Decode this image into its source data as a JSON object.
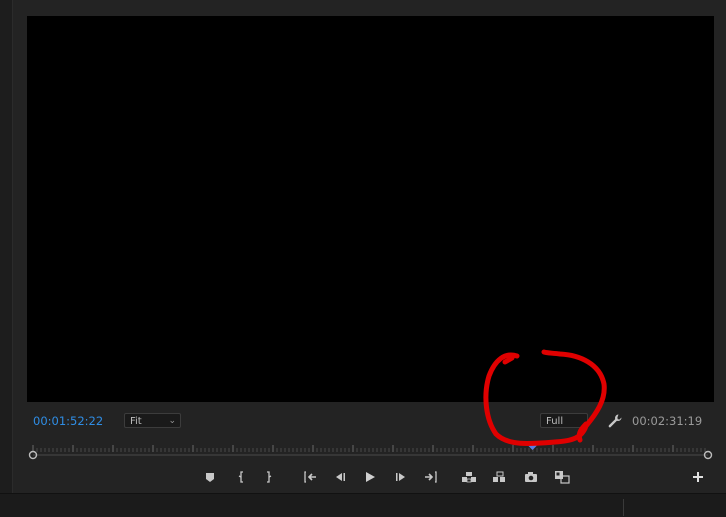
{
  "program_monitor": {
    "current_timecode": "00:01:52:22",
    "duration_timecode": "00:02:31:19",
    "zoom_level": "Fit",
    "playback_resolution": "Full",
    "playhead_position_fraction": 0.74
  },
  "transport_controls": [
    {
      "name": "add-marker-button",
      "icon": "marker-icon"
    },
    {
      "name": "mark-in-button",
      "icon": "mark-in-icon"
    },
    {
      "name": "mark-out-button",
      "icon": "mark-out-icon"
    },
    {
      "name": "go-to-in-button",
      "icon": "go-to-in-icon"
    },
    {
      "name": "step-back-button",
      "icon": "step-back-icon"
    },
    {
      "name": "play-button",
      "icon": "play-icon"
    },
    {
      "name": "step-forward-button",
      "icon": "step-forward-icon"
    },
    {
      "name": "go-to-out-button",
      "icon": "go-to-out-icon"
    },
    {
      "name": "lift-button",
      "icon": "lift-icon"
    },
    {
      "name": "extract-button",
      "icon": "extract-icon"
    },
    {
      "name": "export-frame-button",
      "icon": "camera-icon"
    },
    {
      "name": "comparison-view-button",
      "icon": "comparison-view-icon"
    },
    {
      "name": "button-editor-button",
      "icon": "plus-icon"
    }
  ],
  "colors": {
    "timecode_active": "#2f8de4",
    "annotation": "#e00000",
    "playhead": "#5b7de0"
  }
}
